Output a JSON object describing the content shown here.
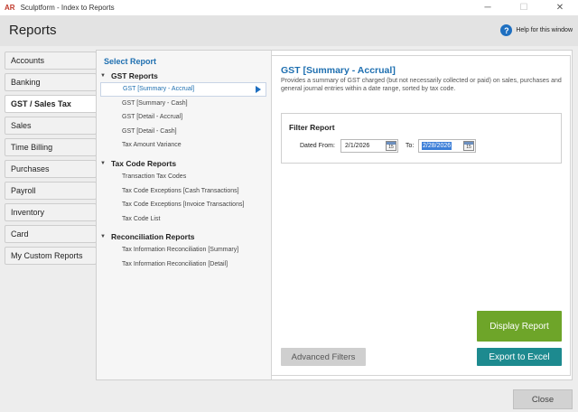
{
  "window": {
    "logo": "AR",
    "title": "Sculptform - Index to Reports",
    "minimize": "─",
    "maximize": "☐",
    "close": "✕"
  },
  "header": {
    "title": "Reports",
    "help_icon": "question-circle-icon",
    "help_icon_glyph": "?",
    "help_label": "Help for this window"
  },
  "tabs": [
    {
      "label": "Accounts"
    },
    {
      "label": "Banking"
    },
    {
      "label": "GST / Sales Tax"
    },
    {
      "label": "Sales"
    },
    {
      "label": "Time Billing"
    },
    {
      "label": "Purchases"
    },
    {
      "label": "Payroll"
    },
    {
      "label": "Inventory"
    },
    {
      "label": "Card"
    },
    {
      "label": "My Custom Reports"
    }
  ],
  "active_tab": "GST / Sales Tax",
  "report_list": {
    "heading": "Select Report",
    "groups": [
      {
        "title": "GST Reports",
        "items": [
          "GST [Summary - Accrual]",
          "GST [Summary - Cash]",
          "GST [Detail - Accrual]",
          "GST [Detail - Cash]",
          "Tax Amount Variance"
        ]
      },
      {
        "title": "Tax Code Reports",
        "items": [
          "Transaction Tax Codes",
          "Tax Code Exceptions [Cash Transactions]",
          "Tax Code Exceptions [Invoice Transactions]",
          "Tax Code List"
        ]
      },
      {
        "title": "Reconciliation Reports",
        "items": [
          "Tax Information Reconciliation [Summary]",
          "Tax Information Reconciliation [Detail]"
        ]
      }
    ],
    "selected": "GST [Summary - Accrual]"
  },
  "detail": {
    "title": "GST [Summary - Accrual]",
    "description": "Provides a summary of GST charged (but not necessarily collected or paid) on sales, purchases and general journal entries within a date range, sorted by tax code.",
    "filter": {
      "title": "Filter Report",
      "dated_from_label": "Dated From:",
      "dated_from_value": "2/1/2026",
      "to_label": "To:",
      "to_value": "2/28/2026",
      "calendar_day": "15"
    },
    "buttons": {
      "display": "Display Report",
      "excel": "Export to Excel",
      "advanced": "Advanced Filters"
    }
  },
  "footer": {
    "close": "Close"
  },
  "colors": {
    "accent_blue": "#1e6fb0",
    "display_green": "#6ea529",
    "excel_teal": "#1d8a8f"
  }
}
